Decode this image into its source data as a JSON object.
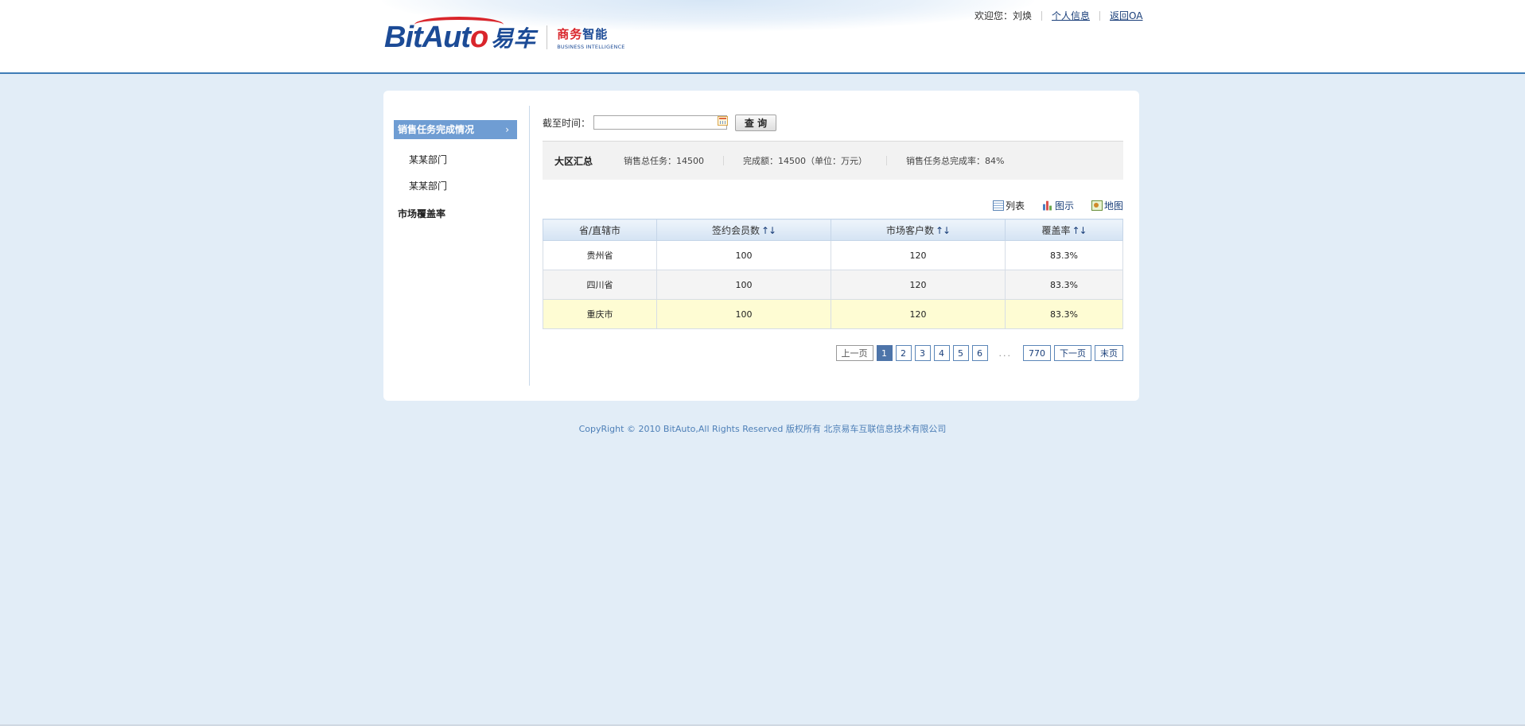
{
  "header": {
    "logo_text": "BitAuto易车",
    "bi_cn_red": "商务",
    "bi_cn_blue": "智能",
    "bi_en": "BUSINESS INTELLIGENCE",
    "welcome": "欢迎您：刘焕",
    "profile_link": "个人信息",
    "return_link": "返回OA"
  },
  "sidebar": {
    "active": "销售任务完成情况",
    "active_arrow": "›",
    "sub_items": [
      "某某部门",
      "某某部门"
    ],
    "other": "市场覆盖率"
  },
  "query": {
    "label": "截至时间：",
    "date_value": "",
    "button": "查 询"
  },
  "summary": {
    "title": "大区汇总",
    "total_task": "销售总任务：14500",
    "completed": "完成额：14500（单位：万元）",
    "rate": "销售任务总完成率：84%"
  },
  "views": {
    "list": "列表",
    "chart": "图示",
    "map": "地图"
  },
  "table": {
    "headers": [
      "省/直辖市",
      "签约会员数",
      "市场客户数",
      "覆盖率"
    ],
    "sort_glyph": "↑↓",
    "rows": [
      [
        "贵州省",
        "100",
        "120",
        "83.3%"
      ],
      [
        "四川省",
        "100",
        "120",
        "83.3%"
      ],
      [
        "重庆市",
        "100",
        "120",
        "83.3%"
      ]
    ]
  },
  "pager": {
    "prev": "上一页",
    "pages": [
      "1",
      "2",
      "3",
      "4",
      "5",
      "6"
    ],
    "ellipsis": "...",
    "last_page": "770",
    "next": "下一页",
    "end": "末页"
  },
  "footer": {
    "copyright": "CopyRight © 2010 BitAuto,All Rights Reserved 版权所有 北京易车互联信息技术有限公司"
  },
  "colors": {
    "accent": "#3f7cb6",
    "sidebar_active": "#6f9dd3",
    "highlight_row": "#fefcd3",
    "background": "#e2edf7"
  }
}
